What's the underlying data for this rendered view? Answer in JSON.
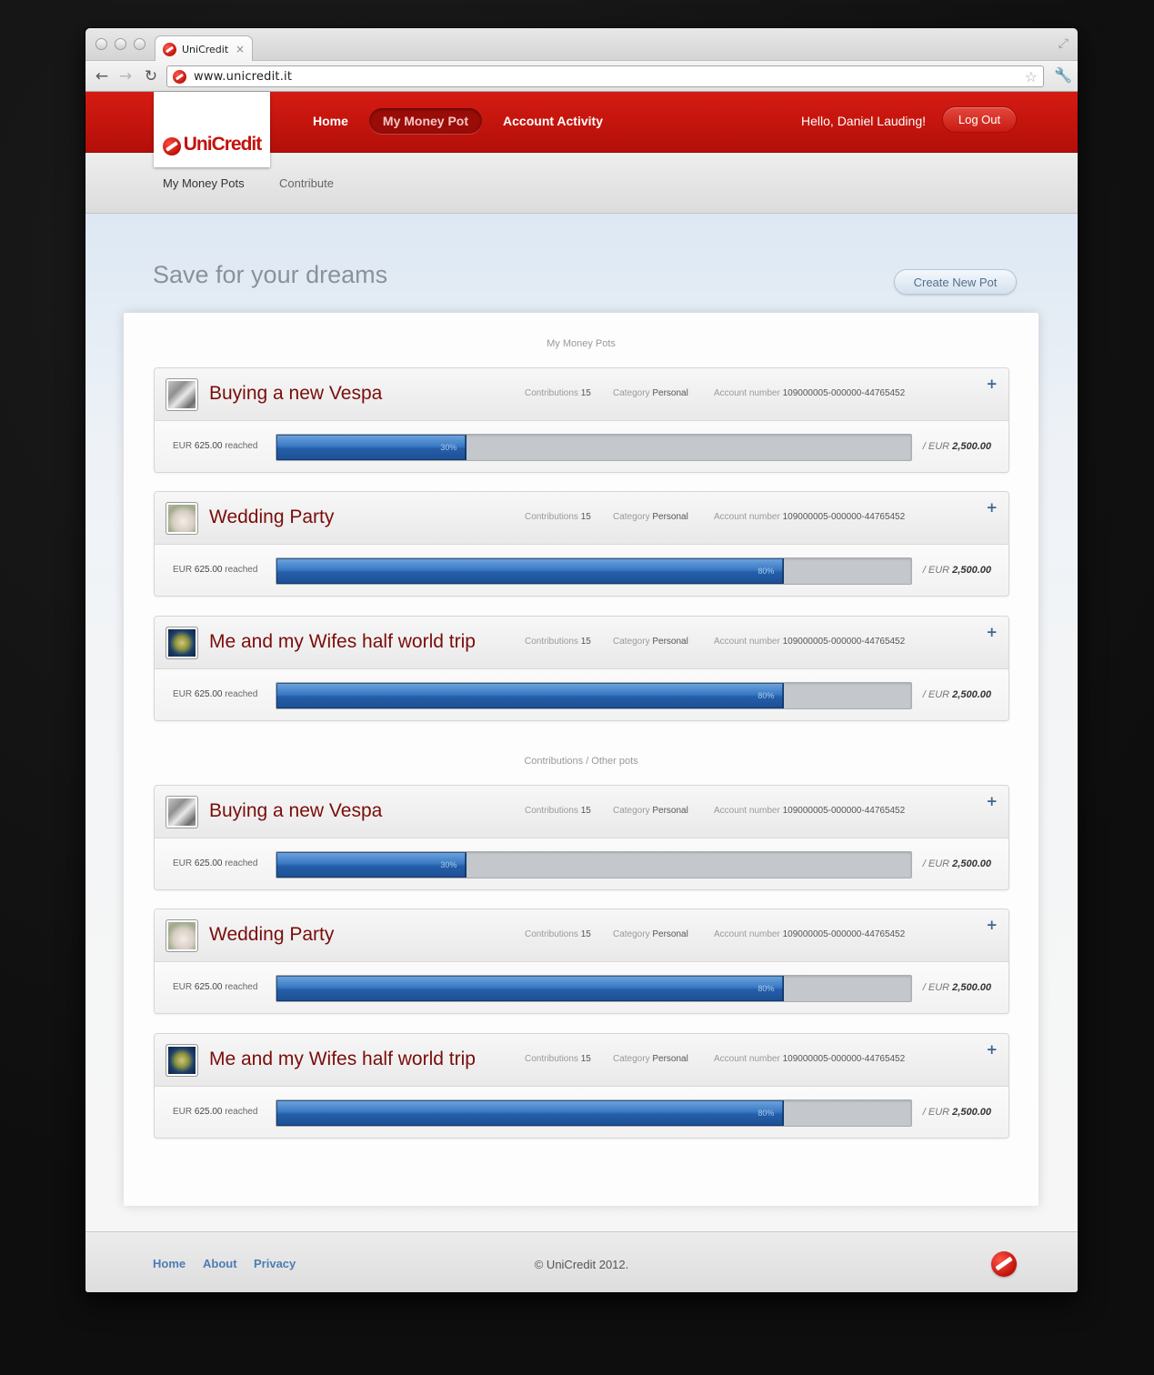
{
  "browser": {
    "tab_title": "UniCredit",
    "tab_close": "×",
    "url": "www.unicredit.it"
  },
  "header": {
    "logo_text": "UniCredit",
    "nav": [
      "Home",
      "My Money Pot",
      "Account Activity"
    ],
    "active_nav": "My Money Pot",
    "greeting": "Hello,  Daniel Lauding!",
    "logout_label": "Log Out"
  },
  "subnav": {
    "items": [
      "My Money Pots",
      "Contribute"
    ]
  },
  "main": {
    "page_title": "Save for your dreams",
    "create_button": "Create New Pot",
    "section_my_pots": "My Money Pots",
    "section_other": "Contributions / Other pots"
  },
  "pots": [
    {
      "title": "Buying a new Vespa",
      "thumb": "vespa-photo",
      "contrib_label": "Contributions",
      "contrib": "15",
      "cat_label": "Category",
      "category": "Personal",
      "acct_label": "Account number",
      "account": "109000005-000000-44765452",
      "reached_prefix": "EUR",
      "reached_amount": "625.00",
      "reached_suffix": "reached",
      "progress_pct": 30,
      "progress_label": "30%",
      "target_prefix": "/ EUR",
      "target_amount": "2,500.00"
    },
    {
      "title": "Wedding Party",
      "thumb": "wedding-photo",
      "contrib_label": "Contributions",
      "contrib": "15",
      "cat_label": "Category",
      "category": "Personal",
      "acct_label": "Account number",
      "account": "109000005-000000-44765452",
      "reached_prefix": "EUR",
      "reached_amount": "625.00",
      "reached_suffix": "reached",
      "progress_pct": 80,
      "progress_label": "80%",
      "target_prefix": "/ EUR",
      "target_amount": "2,500.00"
    },
    {
      "title": "Me and my Wifes half world trip",
      "thumb": "world-photo",
      "contrib_label": "Contributions",
      "contrib": "15",
      "cat_label": "Category",
      "category": "Personal",
      "acct_label": "Account number",
      "account": "109000005-000000-44765452",
      "reached_prefix": "EUR",
      "reached_amount": "625.00",
      "reached_suffix": "reached",
      "progress_pct": 80,
      "progress_label": "80%",
      "target_prefix": "/ EUR",
      "target_amount": "2,500.00"
    },
    {
      "title": "Buying a new Vespa",
      "thumb": "vespa-photo",
      "contrib_label": "Contributions",
      "contrib": "15",
      "cat_label": "Category",
      "category": "Personal",
      "acct_label": "Account number",
      "account": "109000005-000000-44765452",
      "reached_prefix": "EUR",
      "reached_amount": "625.00",
      "reached_suffix": "reached",
      "progress_pct": 30,
      "progress_label": "30%",
      "target_prefix": "/ EUR",
      "target_amount": "2,500.00"
    },
    {
      "title": "Wedding Party",
      "thumb": "wedding-photo",
      "contrib_label": "Contributions",
      "contrib": "15",
      "cat_label": "Category",
      "category": "Personal",
      "acct_label": "Account number",
      "account": "109000005-000000-44765452",
      "reached_prefix": "EUR",
      "reached_amount": "625.00",
      "reached_suffix": "reached",
      "progress_pct": 80,
      "progress_label": "80%",
      "target_prefix": "/ EUR",
      "target_amount": "2,500.00"
    },
    {
      "title": "Me and my Wifes half world trip",
      "thumb": "world-photo",
      "contrib_label": "Contributions",
      "contrib": "15",
      "cat_label": "Category",
      "category": "Personal",
      "acct_label": "Account number",
      "account": "109000005-000000-44765452",
      "reached_prefix": "EUR",
      "reached_amount": "625.00",
      "reached_suffix": "reached",
      "progress_pct": 80,
      "progress_label": "80%",
      "target_prefix": "/ EUR",
      "target_amount": "2,500.00"
    }
  ],
  "footer": {
    "links": [
      "Home",
      "About",
      "Privacy"
    ],
    "copyright": "© UniCredit 2012."
  },
  "colors": {
    "brand_red": "#c4120b",
    "progress_blue": "#245ea9",
    "link_blue": "#4d7cb5"
  },
  "icons": [
    "back-arrow-icon",
    "forward-arrow-icon",
    "reload-icon",
    "star-icon",
    "wrench-icon",
    "resize-icon",
    "plus-icon",
    "unicredit-logo-icon"
  ]
}
